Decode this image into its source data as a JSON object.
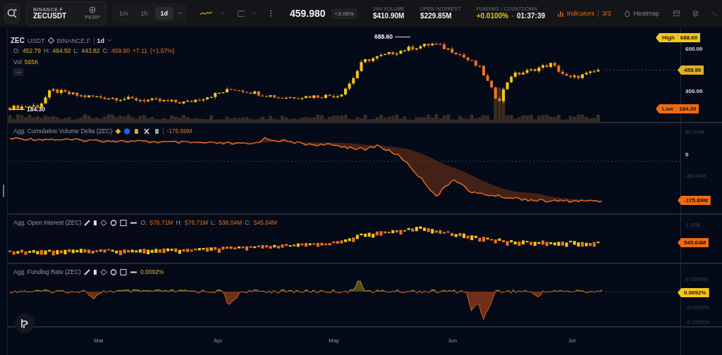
{
  "toolbar": {
    "exchange": "BINANCE.F",
    "symbol": "ZECUSDT",
    "badge": "PERP",
    "intervals": [
      {
        "label": "1m",
        "selected": false
      },
      {
        "label": "1h",
        "selected": false
      },
      {
        "label": "1d",
        "selected": true
      }
    ],
    "price": "459.980",
    "change": "+3.06%",
    "stats": [
      {
        "label": "24H VOLUME",
        "value": "$410.90M"
      },
      {
        "label": "OPEN INTEREST",
        "value": "$229.85M"
      }
    ],
    "funding": {
      "label": "FUNDING / COUNTDOWN",
      "rate": "+0.0100%",
      "countdown": "01:37:39"
    },
    "indicators": {
      "label": "Indicators",
      "count": "3/3"
    },
    "heatmap": "Heatmap"
  },
  "price_pane": {
    "base": "ZEC",
    "quote": "USDT",
    "exchange": "BINANCE.F",
    "interval": "1d",
    "ohlc": [
      {
        "label": "O:",
        "value": "452.79"
      },
      {
        "label": "H:",
        "value": "464.50"
      },
      {
        "label": "L:",
        "value": "443.82"
      },
      {
        "label": "C:",
        "value": "459.90"
      }
    ],
    "change": "+7.11",
    "change_pct": "(+1.57%)",
    "volume_label": "Vol",
    "volume": "565K",
    "high_note": "688.60",
    "low_note": "184.30",
    "axis": {
      "high_label": "High",
      "high": "688.60",
      "ticks": [
        "600.00",
        "300.00"
      ],
      "last": "459.90",
      "low_label": "Low",
      "low": "184.30"
    }
  },
  "cvd_pane": {
    "title": "Agg. Cumulative Volume Delta (ZEC)",
    "value": "-175.89M",
    "ticks": [
      "80.00M",
      "0",
      "-80.00M"
    ],
    "last": "-175.89M"
  },
  "oi_pane": {
    "title": "Agg. Open Interest (ZEC)",
    "ohlc": [
      {
        "label": "O:",
        "value": "576.71M"
      },
      {
        "label": "H:",
        "value": "576.71M"
      },
      {
        "label": "L:",
        "value": "538.04M"
      },
      {
        "label": "C:",
        "value": "545.64M"
      }
    ],
    "ticks": [
      "1.00B"
    ],
    "last": "545.64M"
  },
  "funding_pane": {
    "title": "Agg. Funding Rate (ZEC)",
    "value": "0.0092%",
    "ticks": [
      "0.0500%",
      "-0.0500%",
      "-0.1000%"
    ],
    "last": "0.0092%"
  },
  "time_axis": [
    "Mar",
    "Apr",
    "May",
    "Jun",
    "Jul"
  ]
}
